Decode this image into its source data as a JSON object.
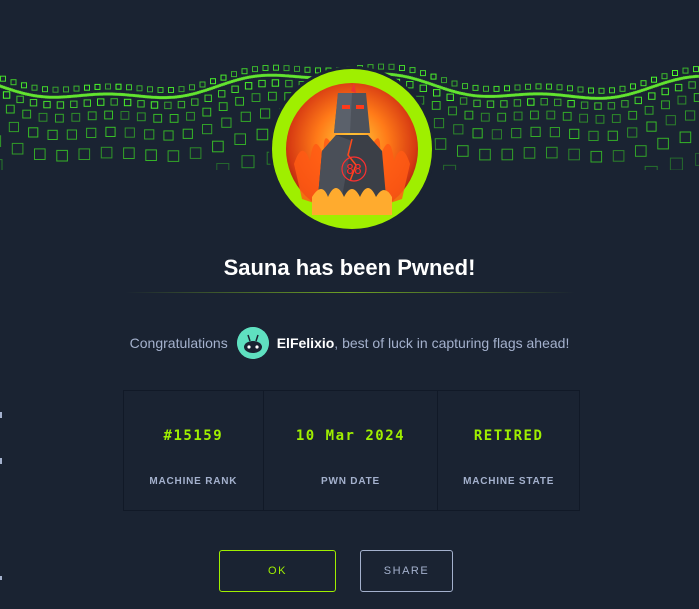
{
  "title": "Sauna has been Pwned!",
  "congrats": {
    "prefix": "Congratulations",
    "username": "ElFelixio",
    "suffix": ", best of luck in capturing flags ahead!"
  },
  "stats": [
    {
      "value": "#15159",
      "label": "MACHINE RANK"
    },
    {
      "value": "10 Mar 2024",
      "label": "PWN DATE"
    },
    {
      "value": "RETIRED",
      "label": "MACHINE STATE"
    }
  ],
  "buttons": {
    "ok": "OK",
    "share": "SHARE"
  },
  "colors": {
    "background": "#1a2332",
    "accent": "#9fef00",
    "muted": "#a4b1cd"
  }
}
